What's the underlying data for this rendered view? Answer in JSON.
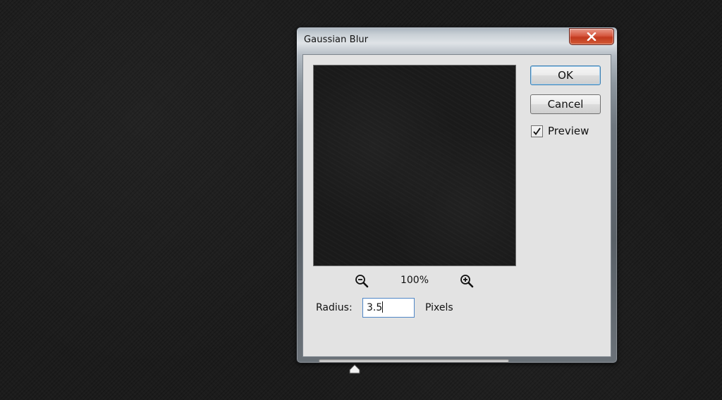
{
  "dialog": {
    "title": "Gaussian Blur",
    "close_label": "×"
  },
  "buttons": {
    "ok_label": "OK",
    "cancel_label": "Cancel"
  },
  "preview": {
    "label": "Preview",
    "checked": true
  },
  "zoom": {
    "level": "100%",
    "zoom_out_icon": "zoom-out-icon",
    "zoom_in_icon": "zoom-in-icon"
  },
  "radius": {
    "label": "Radius:",
    "value": "3.5",
    "units": "Pixels",
    "slider_fraction": 0.19
  },
  "colors": {
    "close_red": "#c8442a",
    "ok_focus_border": "#3c7fb1",
    "input_focus_border": "#4f86c6"
  }
}
